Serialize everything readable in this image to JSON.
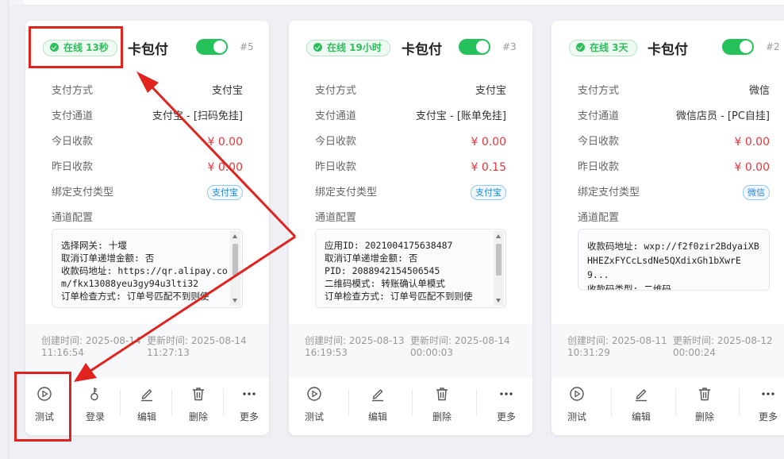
{
  "cards": [
    {
      "status": "在线 13秒",
      "title": "卡包付",
      "enabled": true,
      "no": "#5",
      "rows": {
        "pay_method": {
          "label": "支付方式",
          "value": "支付宝"
        },
        "channel": {
          "label": "支付通道",
          "value": "支付宝 - [扫码免挂]"
        },
        "today": {
          "label": "今日收款",
          "value": "¥ 0.00"
        },
        "yesterday": {
          "label": "昨日收款",
          "value": "¥ 0.00"
        },
        "bind_type": {
          "label": "绑定支付类型",
          "value": "支付宝"
        },
        "config": {
          "label": "通道配置"
        }
      },
      "config_lines": [
        "选择网关: 十堰",
        "取消订单递增金额: 否",
        "收款码地址: https://qr.alipay.co",
        "m/fkx13088yeu3gy94u3lti32",
        "订单检查方式: 订单号匹配不到则使"
      ],
      "created": "创建时间: 2025-08-14 11:16:54",
      "created_l1": "创建时间: 2025-08-14",
      "created_l2": "11:16:54",
      "updated_l1": "更新时间: 2025-08-14",
      "updated_l2": "11:27:13",
      "actions": [
        "测试",
        "登录",
        "编辑",
        "删除",
        "更多"
      ]
    },
    {
      "status": "在线 19小时",
      "title": "卡包付",
      "enabled": true,
      "no": "#3",
      "rows": {
        "pay_method": {
          "label": "支付方式",
          "value": "支付宝"
        },
        "channel": {
          "label": "支付通道",
          "value": "支付宝 - [账单免挂]"
        },
        "today": {
          "label": "今日收款",
          "value": "¥ 0.00"
        },
        "yesterday": {
          "label": "昨日收款",
          "value": "¥ 0.15"
        },
        "bind_type": {
          "label": "绑定支付类型",
          "value": "支付宝"
        },
        "config": {
          "label": "通道配置"
        }
      },
      "config_lines": [
        "应用ID: 2021004175638487",
        "取消订单递增金额: 否",
        "PID: 2088942154506545",
        "二维码模式: 转账确认单模式",
        "订单检查方式: 订单号匹配不到则使"
      ],
      "created_l1": "创建时间: 2025-08-13",
      "created_l2": "16:19:53",
      "updated_l1": "更新时间: 2025-08-14",
      "updated_l2": "00:00:03",
      "actions": [
        "测试",
        "编辑",
        "删除",
        "更多"
      ]
    },
    {
      "status": "在线 3天",
      "title": "卡包付",
      "enabled": true,
      "no": "#2",
      "rows": {
        "pay_method": {
          "label": "支付方式",
          "value": "微信"
        },
        "channel": {
          "label": "支付通道",
          "value": "微信店员 - [PC自挂]"
        },
        "today": {
          "label": "今日收款",
          "value": "¥ 0.00"
        },
        "yesterday": {
          "label": "昨日收款",
          "value": "¥ 0.00"
        },
        "bind_type": {
          "label": "绑定支付类型",
          "value": "微信"
        },
        "config": {
          "label": "通道配置"
        }
      },
      "config_text": "收款码地址: wxp://f2f0zir2BdyaiXBHHEZxFYCcLsdNe5QXdixGh1bXwrE9...",
      "config_line2": "收款码类型: 二维码",
      "created_l1": "创建时间: 2025-08-11",
      "created_l2": "10:31:29",
      "updated_l1": "更新时间: 2025-08-12",
      "updated_l2": "00:00:24",
      "actions": [
        "测试",
        "编辑",
        "删除",
        "更多"
      ]
    }
  ],
  "colors": {
    "accent_green": "#25c15a",
    "money_red": "#e5383b",
    "highlight_red": "#e0231e",
    "tag_blue": "#1e88e5"
  }
}
